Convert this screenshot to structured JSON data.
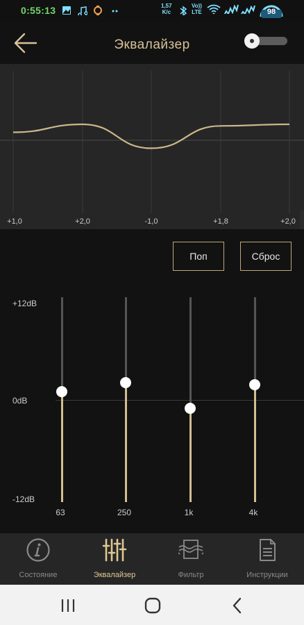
{
  "status_bar": {
    "time": "0:55:13",
    "speed_value": "1,57",
    "speed_unit": "K/c",
    "volte_top": "Vo))",
    "volte_bottom": "LTE",
    "battery": "98",
    "time_color": "#6fd86a",
    "icon_color": "#7fe0ff"
  },
  "header": {
    "back_icon": "arrow-left-icon",
    "title": "Эквалайзер",
    "toggle_on": false
  },
  "curve": {
    "labels": [
      "+1,0",
      "+2,0",
      "-1,0",
      "+1,8",
      "+2,0"
    ],
    "line_color": "#cdb88b"
  },
  "controls": {
    "preset_label": "Поп",
    "reset_label": "Сброс"
  },
  "equalizer": {
    "db_max": "+12dB",
    "db_zero": "0dB",
    "db_min": "-12dB",
    "range_db": [
      -12,
      12
    ],
    "accent_color": "#d4bf92",
    "bands": [
      {
        "freq": "63",
        "gain_db": 1.0
      },
      {
        "freq": "250",
        "gain_db": 2.0
      },
      {
        "freq": "1k",
        "gain_db": -1.0
      },
      {
        "freq": "4k",
        "gain_db": 1.8
      }
    ]
  },
  "bottom_nav": {
    "items": [
      {
        "label": "Состояние",
        "icon": "info-icon",
        "active": false
      },
      {
        "label": "Эквалайзер",
        "icon": "sliders-icon",
        "active": true
      },
      {
        "label": "Фильтр",
        "icon": "filter-icon",
        "active": false
      },
      {
        "label": "Инструкции",
        "icon": "document-icon",
        "active": false
      }
    ]
  },
  "system_nav": {
    "recent": "recent-apps-icon",
    "home": "home-icon",
    "back": "back-icon"
  }
}
